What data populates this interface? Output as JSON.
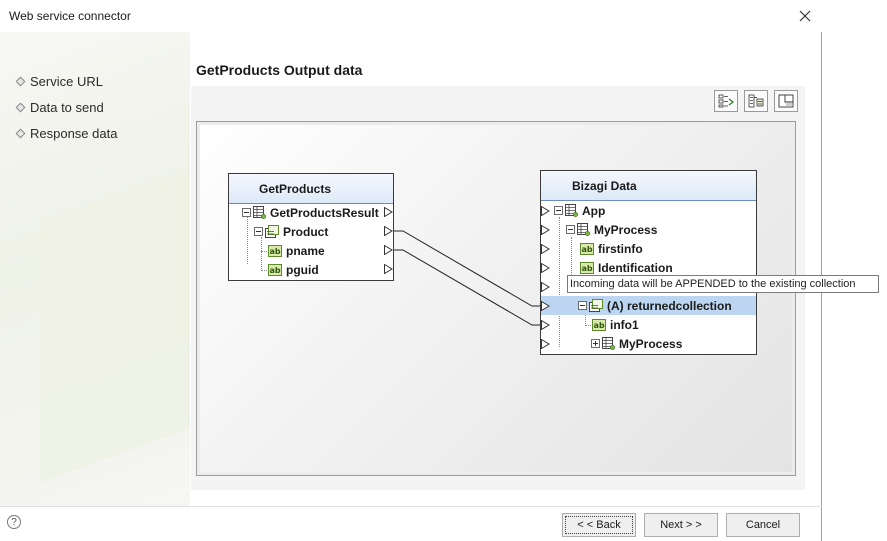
{
  "window": {
    "title": "Web service connector"
  },
  "nav": {
    "items": [
      {
        "label": "Service URL"
      },
      {
        "label": "Data to send"
      },
      {
        "label": "Response data"
      }
    ]
  },
  "page": {
    "title": "GetProducts Output data"
  },
  "toolbar": {
    "icons": [
      "auto-map-icon",
      "show-mapped-icon",
      "fit-view-icon"
    ]
  },
  "source_node": {
    "title": "GetProducts",
    "rows": [
      {
        "label": "GetProductsResult",
        "icon": "table-icon"
      },
      {
        "label": "Product",
        "icon": "collection-icon"
      },
      {
        "label": "pname",
        "icon": "text-attribute-icon"
      },
      {
        "label": "pguid",
        "icon": "text-attribute-icon"
      }
    ]
  },
  "target_node": {
    "title": "Bizagi Data",
    "rows": [
      {
        "label": "App",
        "icon": "table-icon"
      },
      {
        "label": "MyProcess",
        "icon": "table-icon"
      },
      {
        "label": "firstinfo",
        "icon": "text-attribute-icon"
      },
      {
        "label": "Identification",
        "icon": "text-attribute-icon"
      },
      {
        "label": "",
        "icon": ""
      },
      {
        "label": "(A) returnedcollection",
        "icon": "collection-icon"
      },
      {
        "label": "info1",
        "icon": "text-attribute-icon"
      },
      {
        "label": "MyProcess",
        "icon": "table-icon"
      }
    ]
  },
  "tooltip": {
    "text": "Incoming data will be APPENDED to the existing collection"
  },
  "buttons": {
    "back": "< < Back",
    "next": "Next > >",
    "cancel": "Cancel"
  },
  "help_label": "?",
  "colors": {
    "selection": "#bcd6f1",
    "header": "#dde9f8",
    "accent": "#6c8cb5"
  }
}
